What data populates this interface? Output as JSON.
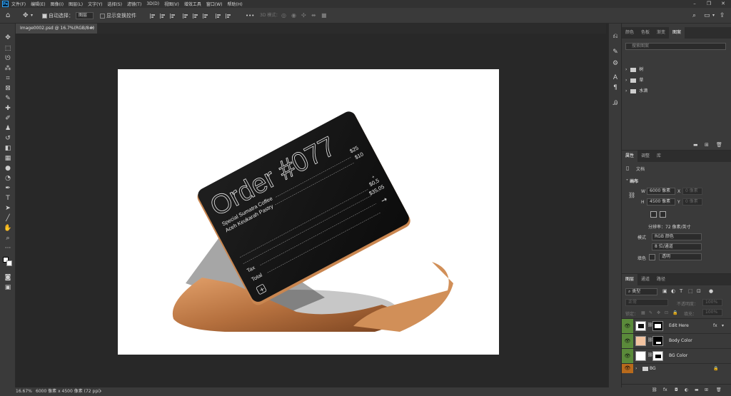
{
  "app": {
    "logo": "Ps",
    "title_controls": [
      "–",
      "❐",
      "✕"
    ]
  },
  "menu": [
    "文件(F)",
    "编辑(E)",
    "图像(I)",
    "图层(L)",
    "文字(Y)",
    "选择(S)",
    "滤镜(T)",
    "3D(D)",
    "视图(V)",
    "增效工具",
    "窗口(W)",
    "帮助(H)"
  ],
  "options": {
    "auto_select_label": "自动选择：",
    "auto_select_target": "图层",
    "transform_label": "显示变换控件",
    "mode_3d_label": "3D 模式：",
    "more": "•••"
  },
  "document": {
    "tab_title": "Image0002.psd @ 16.7%(RGB/8#)",
    "close": "×",
    "card": {
      "title": "Order #077",
      "items": [
        {
          "name": "Special Sumatra Coffee",
          "price": "$25"
        },
        {
          "name": "Aceh Keukarah Pastry",
          "price": "$10"
        }
      ],
      "plus_mark": "+",
      "tax_label": "Tax",
      "tax_value": "$0,5",
      "total_label": "Total",
      "total_value": "$35,05",
      "arrow": "→",
      "add_icon": "+"
    }
  },
  "status": {
    "zoom": "16.67%",
    "info": "6000 像素 x 4500 像素 (72 ppi)",
    "arrow": "›"
  },
  "right_top_tabs": [
    "颜色",
    "色板",
    "渐变",
    "图案"
  ],
  "patterns": {
    "search_placeholder": "搜索图案",
    "folders": [
      "树",
      "草",
      "水滴"
    ]
  },
  "properties": {
    "tabs": [
      "属性",
      "调整",
      "库"
    ],
    "doc_label": "文档",
    "canvas_section": "画布",
    "w_label": "W",
    "w_value": "6000 像素",
    "x_label": "X",
    "x_value": "0 像素",
    "h_label": "H",
    "h_value": "4500 像素",
    "y_label": "Y",
    "y_value": "0 像素",
    "resolution": "分辨率：72 像素/英寸",
    "mode_label": "模式",
    "mode_value": "RGB 颜色",
    "depth_value": "8 位/通道",
    "fill_label": "填色",
    "fill_value": "透明"
  },
  "layers_panel": {
    "tabs": [
      "图层",
      "通道",
      "路径"
    ],
    "filter_kind": "类型",
    "blend_mode": "正常",
    "opacity_label": "不透明度：",
    "opacity_value": "100%",
    "lock_label": "锁定：",
    "fill_label": "填充：",
    "fill_value": "100%",
    "layers": [
      {
        "name": "Edit Here",
        "fx": "fx",
        "eye_color": "#5a8a3a"
      },
      {
        "name": "Body Color",
        "eye_color": "#5a8a3a"
      },
      {
        "name": "BG Color",
        "eye_color": "#5a8a3a"
      },
      {
        "name": "BG",
        "eye_color": "#b86a1c"
      }
    ]
  },
  "colors": {
    "accent": "#31a8ff",
    "green_eye": "#5a8a3a",
    "orange_eye": "#b86a1c",
    "card_bg": "#141414",
    "stand_copper": "#c98650",
    "body_swatch": "#f2c3a0"
  }
}
